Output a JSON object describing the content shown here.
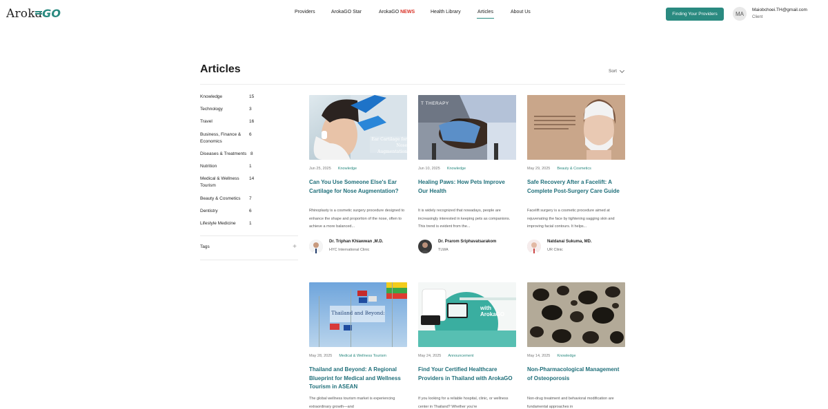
{
  "header": {
    "logo_text": "Aroka",
    "logo_go": "GO",
    "nav": [
      {
        "label": "Providers"
      },
      {
        "label": "ArokaGO Star"
      },
      {
        "label": "ArokaGO ",
        "badge": "NEWS"
      },
      {
        "label": "Health Library"
      },
      {
        "label": "Articles",
        "active": true
      },
      {
        "label": "About Us"
      }
    ],
    "cta_label": "Finding Your Providers",
    "user_initials": "MA",
    "user_email": "Maiobchoei.TH@gmail.com",
    "user_role": "Client"
  },
  "page": {
    "title": "Articles",
    "sort_label": "Sort"
  },
  "sidebar": {
    "categories": [
      {
        "name": "Knowledge",
        "count": "15"
      },
      {
        "name": "Technology",
        "count": "3"
      },
      {
        "name": "Travel",
        "count": "16"
      },
      {
        "name": "Business, Finance & Economics",
        "count": "6"
      },
      {
        "name": "Diseases & Treatments",
        "count": "8"
      },
      {
        "name": "Nutrition",
        "count": "1"
      },
      {
        "name": "Medical & Wellness Tourism",
        "count": "14"
      },
      {
        "name": "Beauty & Cosmetics",
        "count": "7"
      },
      {
        "name": "Dentistry",
        "count": "6"
      },
      {
        "name": "Lifestyle Medicine",
        "count": "1"
      }
    ],
    "tags_label": "Tags"
  },
  "cards": [
    {
      "date": "Jun 25, 2025",
      "tag": "Knowledge",
      "title": "Can You Use Someone Else's Ear Cartilage for Nose Augmentation?",
      "excerpt": "Rhinoplasty is a cosmetic surgery procedure designed to enhance the shape and proportion of the nose, often to achieve a more balanced...",
      "author": "Dr. Triphan Khiawwan ,M.D.",
      "clinic": "HYC International Clinic",
      "image_caption": "Ear Cartilage for Nose Augmentation"
    },
    {
      "date": "Jun 10, 2025",
      "tag": "Knowledge",
      "title": "Healing Paws: How Pets Improve Our Health",
      "excerpt": "It is widely recognized that nowadays, people are increasingly interested in keeping pets as companions. This trend is evident from the...",
      "author": "Dr. Prarom Sriphavatsarakom",
      "clinic": "TLWA",
      "image_caption": "T THERAPY"
    },
    {
      "date": "May 29, 2025",
      "tag": "Beauty & Cosmetics",
      "title": "Safe Recovery After a Facelift: A Complete Post-Surgery Care Guide",
      "excerpt": "Facelift surgery is a cosmetic procedure aimed at rejuvenating the face by tightening sagging skin and improving facial contours. It helps...",
      "author": "Natdanai Sukuma, MD.",
      "clinic": "UR Clinic",
      "image_caption": ""
    },
    {
      "date": "May 28, 2025",
      "tag": "Medical & Wellness Tourism",
      "title": "Thailand and Beyond: A Regional Blueprint for Medical and Wellness Tourism in ASEAN",
      "excerpt": "The global wellness tourism market is experiencing extraordinary growth—and",
      "image_caption": "Thailand and Beyond:"
    },
    {
      "date": "May 24, 2025",
      "tag": "Announcement",
      "title": "Find Your Certified Healthcare Providers in Thailand with ArokaGO",
      "excerpt": "If you looking for a reliable hospital, clinic, or wellness center in Thailand? Whether you're",
      "image_caption": "with ArokaGO"
    },
    {
      "date": "May 14, 2025",
      "tag": "Knowledge",
      "title": "Non-Pharmacological Management of Osteoporosis",
      "excerpt": "Non-drug treatment and behavioral modification are fundamental approaches in",
      "image_caption": ""
    }
  ]
}
